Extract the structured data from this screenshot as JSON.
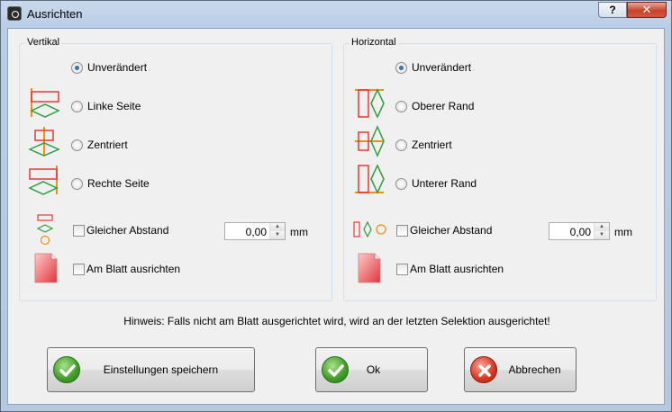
{
  "window": {
    "title": "Ausrichten",
    "help_label": "?",
    "close_label": "✕"
  },
  "vertical": {
    "label": "Vertikal",
    "options": [
      {
        "label": "Unverändert",
        "checked": true
      },
      {
        "label": "Linke Seite",
        "checked": false
      },
      {
        "label": "Zentriert",
        "checked": false
      },
      {
        "label": "Rechte Seite",
        "checked": false
      }
    ],
    "equal_spacing_label": "Gleicher Abstand",
    "equal_spacing_value": "0,00",
    "unit": "mm",
    "align_sheet_label": "Am Blatt ausrichten"
  },
  "horizontal": {
    "label": "Horizontal",
    "options": [
      {
        "label": "Unverändert",
        "checked": true
      },
      {
        "label": "Oberer Rand",
        "checked": false
      },
      {
        "label": "Zentriert",
        "checked": false
      },
      {
        "label": "Unterer Rand",
        "checked": false
      }
    ],
    "equal_spacing_label": "Gleicher Abstand",
    "equal_spacing_value": "0,00",
    "unit": "mm",
    "align_sheet_label": "Am Blatt ausrichten"
  },
  "hint": "Hinweis: Falls nicht am Blatt ausgerichtet wird, wird an der letzten Selektion ausgerichtet!",
  "buttons": {
    "save": "Einstellungen speichern",
    "ok": "Ok",
    "cancel": "Abbrechen"
  },
  "colors": {
    "rect": "#e53935",
    "diamond": "#2e9e3e",
    "line": "#f28c1a",
    "circle": "#f28c1a"
  }
}
